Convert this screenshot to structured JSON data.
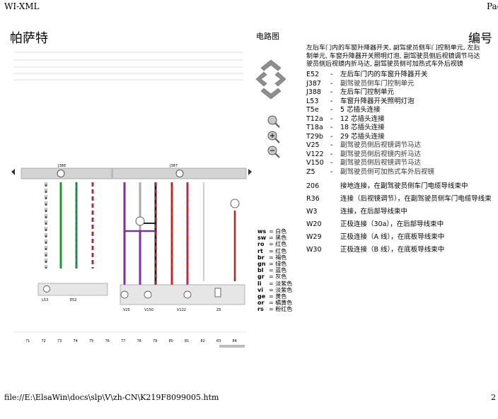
{
  "header": {
    "left": "WI-XML",
    "right": "Pag"
  },
  "footer": {
    "path": "file://E:\\ElsaWin\\docs\\slp\\V\\zh-CN\\K219F8099005.htm",
    "page": "2"
  },
  "doc": {
    "brand": "帕萨特",
    "type": "电路图",
    "number_label": "编号"
  },
  "description": [
    "左后车门内的车窗升降器开关, 副驾驶员侧车门控制单元, 左后",
    "制单元, 车窗升降器开关照明灯泡, 副驾驶员侧后视镜调节马达",
    "驶员侧后视镜内折马达, 副驾驶员侧可加热式车外后视镜"
  ],
  "legend": [
    {
      "code": "E52",
      "text": "左后车门内的车窗升降器开关"
    },
    {
      "code": "J387",
      "text": "副驾驶员侧车门控制单元"
    },
    {
      "code": "J388",
      "text": "左后车门控制单元"
    },
    {
      "code": "L53",
      "text": "车窗升降器开关照明灯泡"
    },
    {
      "code": "T5e",
      "text": "5 芯插头连接"
    },
    {
      "code": "T12a",
      "text": "12 芯插头连接"
    },
    {
      "code": "T18a",
      "text": "18 芯插头连接"
    },
    {
      "code": "T29b",
      "text": "29 芯插头连接"
    },
    {
      "code": "V25",
      "text": "副驾驶员侧后视镜调节马达"
    },
    {
      "code": "V122",
      "text": "副驾驶员侧后视镜内折马达"
    },
    {
      "code": "V150",
      "text": "副驾驶员侧后视镜调节马达"
    },
    {
      "code": "Z5",
      "text": "副驾驶员侧可加热式车外后视镜"
    },
    {
      "code": "206",
      "text": "接地连接，在副驾驶员侧车门电缆导线束中"
    },
    {
      "code": "R36",
      "text": "连接（后视镜调节），在副驾驶员侧车门电缆导线束"
    },
    {
      "code": "W3",
      "text": "连接，在后部导线束中"
    },
    {
      "code": "W20",
      "text": "正极连接（30a），在后部导线束中"
    },
    {
      "code": "W29",
      "text": "正极连接（A 线），在底板导线束中"
    },
    {
      "code": "W30",
      "text": "正极连接（B 线），在底板导线束中"
    }
  ],
  "color_codes": [
    {
      "abbr": "ws",
      "name": "白色"
    },
    {
      "abbr": "sw",
      "name": "黑色"
    },
    {
      "abbr": "ro",
      "name": "红色"
    },
    {
      "abbr": "rt",
      "name": "红色"
    },
    {
      "abbr": "br",
      "name": "褐色"
    },
    {
      "abbr": "gn",
      "name": "绿色"
    },
    {
      "abbr": "bl",
      "name": "蓝色"
    },
    {
      "abbr": "gr",
      "name": "灰色"
    },
    {
      "abbr": "li",
      "name": "淡紫色"
    },
    {
      "abbr": "vi",
      "name": "淡紫色"
    },
    {
      "abbr": "ge",
      "name": "黄色"
    },
    {
      "abbr": "or",
      "name": "橘黄色"
    },
    {
      "abbr": "rs",
      "name": "粉红色"
    }
  ],
  "diagram": {
    "unit_left": "J388",
    "unit_right": "J387",
    "components": [
      "L53",
      "E52",
      "V25",
      "V150",
      "V122",
      "Z5"
    ],
    "track_numbers": [
      "71",
      "72",
      "73",
      "74",
      "75",
      "76",
      "77",
      "78",
      "79",
      "80",
      "81",
      "82",
      "83",
      "84"
    ],
    "wire_sizes": [
      "0.5",
      "0.5",
      "0.5",
      "0.5",
      "0.5",
      "0.5",
      "0.5",
      "0.5",
      "0.5",
      "0.5",
      "0.5",
      "0.5"
    ]
  },
  "nav_icons": [
    "nav-up-icon",
    "nav-left-icon",
    "nav-right-icon",
    "nav-down-icon",
    "zoom-fit-icon",
    "zoom-in-icon",
    "zoom-out-icon"
  ]
}
